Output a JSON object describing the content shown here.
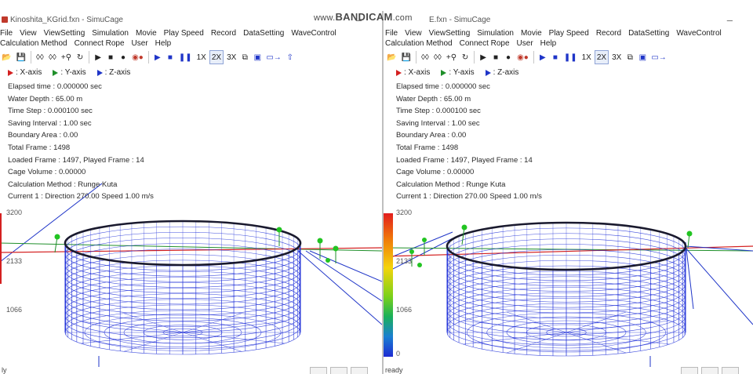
{
  "watermark": {
    "prefix": "www.",
    "brand": "BANDICAM",
    "suffix": ".com"
  },
  "left_window": {
    "title": "Kinoshita_KGrid.fxn - SimuCage",
    "menu": [
      "File",
      "View",
      "ViewSetting",
      "Simulation",
      "Movie",
      "Play Speed",
      "Record",
      "DataSetting",
      "WaveControl",
      "Calculation Method",
      "Connect Rope",
      "User",
      "Help"
    ],
    "status": "ly",
    "scale_top": "3200",
    "scale_labels": [
      "2133",
      "1066"
    ]
  },
  "right_window": {
    "title": "E.fxn - SimuCage",
    "menu": [
      "File",
      "View",
      "ViewSetting",
      "Simulation",
      "Movie",
      "Play Speed",
      "Record",
      "DataSetting",
      "WaveControl",
      "Calculation Method",
      "Connect Rope",
      "User",
      "Help"
    ],
    "status": "ready",
    "scale_top": "3200",
    "scale_labels": [
      "2133",
      "1066"
    ],
    "scale_bottom": "0"
  },
  "toolbar": {
    "speed_1x": "1X",
    "speed_2x": "2X",
    "speed_3x": "3X"
  },
  "axes_legend": {
    "x": ": X-axis",
    "y": ": Y-axis",
    "z": ": Z-axis"
  },
  "info": {
    "elapsed_time": "Elapsed time : 0.000000 sec",
    "water_depth": "Water Depth : 65.00 m",
    "time_step": "Time Step : 0.000100 sec",
    "saving_interval": "Saving Interval : 1.00 sec",
    "boundary_area": "Boundary Area : 0.00",
    "total_frame": "Total Frame : 1498",
    "loaded_frame": "Loaded Frame : 1497, Played Frame : 14",
    "cage_volume": "Cage Volume : 0.00000",
    "calc_method": "Calculation Method : Runge Kuta",
    "current": "Current 1 : Direction 270.00 Speed 1.00 m/s"
  },
  "colors": {
    "x_axis": "#d42020",
    "y_axis": "#1f8f2a",
    "z_axis": "#1f35c8",
    "net": "#2030d8",
    "rim": "#1a1a2e",
    "buoy": "#22c422"
  }
}
